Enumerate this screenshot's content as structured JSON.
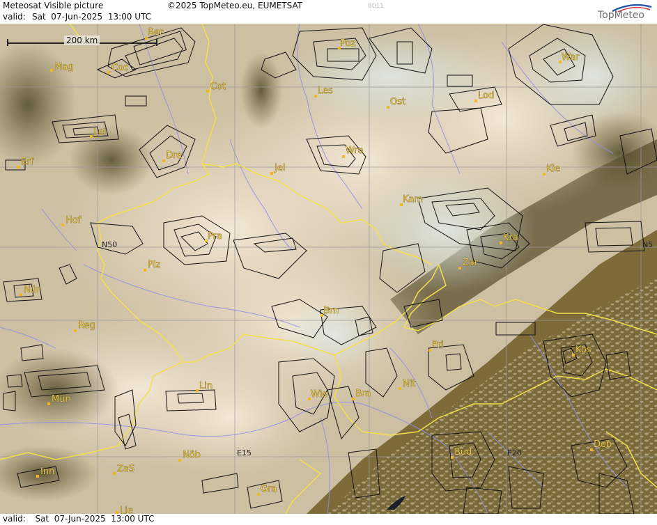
{
  "header": {
    "title": "Meteosat Visible picture",
    "copyright": "©2025 TopMeteo.eu, EUMETSAT",
    "valid_label": "valid:",
    "valid_time": "Sat  07-Jun-2025  13:00 UTC",
    "code": "8011",
    "logo": "TopMeteo"
  },
  "footer": {
    "valid_label": "valid:",
    "valid_time": "Sat  07-Jun-2025  13:00 UTC"
  },
  "scale_bar": {
    "label": "200 km"
  },
  "grid_labels": {
    "lat_left": "N50",
    "lat_right": "N5",
    "lon_15": "E15",
    "lon_20": "E20"
  },
  "cities": [
    {
      "id": "ber",
      "name": "Ber"
    },
    {
      "id": "mag",
      "name": "Mag"
    },
    {
      "id": "coc",
      "name": "Coc"
    },
    {
      "id": "cot",
      "name": "Cot"
    },
    {
      "id": "poz",
      "name": "Poz"
    },
    {
      "id": "war",
      "name": "War"
    },
    {
      "id": "les",
      "name": "Les"
    },
    {
      "id": "ost",
      "name": "Ost"
    },
    {
      "id": "lod",
      "name": "Lod"
    },
    {
      "id": "lei",
      "name": "Lei"
    },
    {
      "id": "dre",
      "name": "Dre"
    },
    {
      "id": "wro",
      "name": "Wro"
    },
    {
      "id": "erf",
      "name": "Erf"
    },
    {
      "id": "jel",
      "name": "Jel"
    },
    {
      "id": "kie",
      "name": "Kie"
    },
    {
      "id": "kam",
      "name": "Kam"
    },
    {
      "id": "hof",
      "name": "Hof"
    },
    {
      "id": "pra",
      "name": "Pra"
    },
    {
      "id": "kra",
      "name": "Kra"
    },
    {
      "id": "plz",
      "name": "Plz"
    },
    {
      "id": "zar",
      "name": "Zar"
    },
    {
      "id": "nur",
      "name": "Nür"
    },
    {
      "id": "brn",
      "name": "Brn"
    },
    {
      "id": "reg",
      "name": "Reg"
    },
    {
      "id": "pri",
      "name": "Pri"
    },
    {
      "id": "kos",
      "name": "Kos"
    },
    {
      "id": "nit",
      "name": "Nit"
    },
    {
      "id": "lin",
      "name": "Lin"
    },
    {
      "id": "mun",
      "name": "Mün"
    },
    {
      "id": "wie",
      "name": "Wie"
    },
    {
      "id": "bra",
      "name": "Bra"
    },
    {
      "id": "bud",
      "name": "Bud"
    },
    {
      "id": "deb",
      "name": "Deb"
    },
    {
      "id": "nob",
      "name": "Nöb"
    },
    {
      "id": "inn",
      "name": "Inn"
    },
    {
      "id": "zas",
      "name": "ZaS"
    },
    {
      "id": "gra",
      "name": "Gra"
    },
    {
      "id": "lie",
      "name": "Lie"
    }
  ],
  "colors": {
    "border": "#f2e04a",
    "rivers": "#8f8fe6",
    "grid": "#9a9a9a",
    "zones": "#111111",
    "city_text": "#e7c74a"
  }
}
